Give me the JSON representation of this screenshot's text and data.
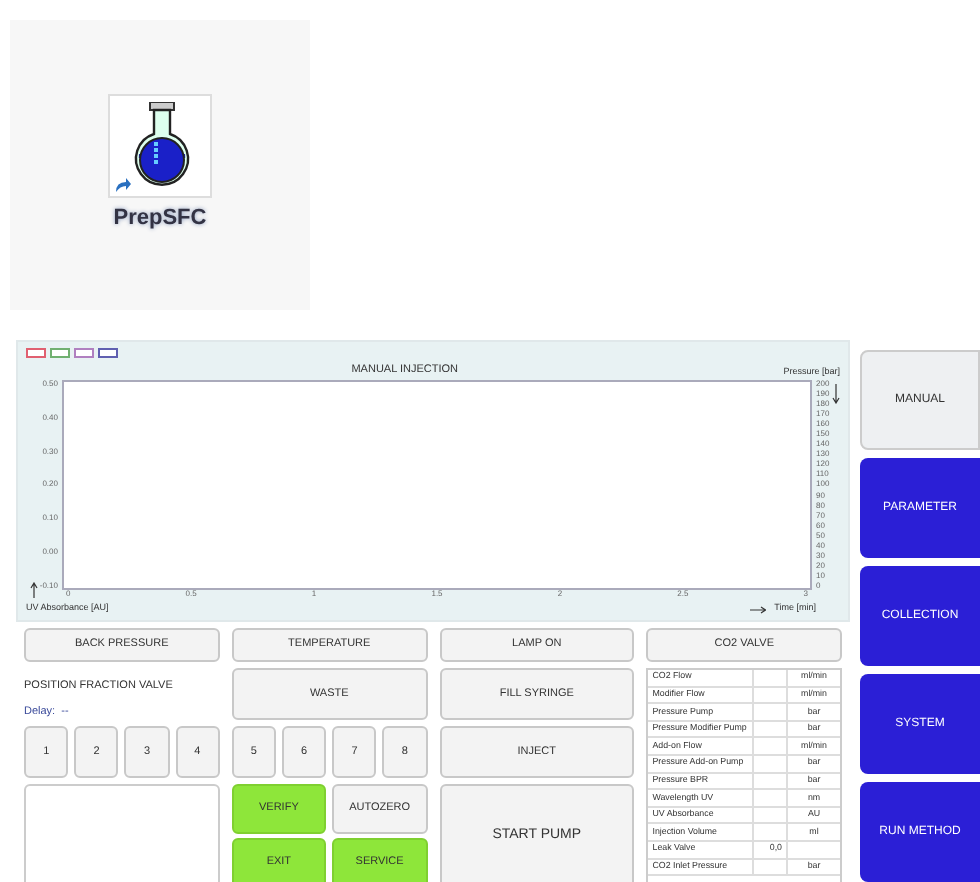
{
  "desktop_icon": {
    "label": "PrepSFC"
  },
  "chart": {
    "legend": [
      {
        "color": "#e06070"
      },
      {
        "color": "#70b070"
      },
      {
        "color": "#b080c0"
      },
      {
        "color": "#6060b0"
      }
    ],
    "title": "MANUAL INJECTION",
    "right_axis_label": "Pressure [bar]",
    "left_axis_label": "UV Absorbance [AU]",
    "x_axis_label": "Time [min]",
    "left_ticks": [
      "0.50",
      "0.40",
      "0.30",
      "0.20",
      "0.10",
      "0.00",
      "-0.10"
    ],
    "x_ticks": [
      "0",
      "0.5",
      "1",
      "1.5",
      "2",
      "2.5",
      "3"
    ],
    "right_ticks": [
      "200",
      "190",
      "180",
      "170",
      "160",
      "150",
      "140",
      "130",
      "120",
      "110",
      "100",
      "90",
      "80",
      "70",
      "60",
      "50",
      "40",
      "30",
      "20",
      "10",
      "0"
    ]
  },
  "top_buttons": [
    "BACK PRESSURE",
    "TEMPERATURE",
    "LAMP ON",
    "CO2 VALVE"
  ],
  "fraction_valve": {
    "title": "POSITION FRACTION VALVE",
    "delay": "Delay:  --",
    "positions": [
      "1",
      "2",
      "3",
      "4",
      "5",
      "6",
      "7",
      "8"
    ]
  },
  "buttons": [
    {
      "label": "WASTE"
    },
    {
      "label": "FILL SYRINGE"
    },
    {
      "label": "INJECT"
    },
    {
      "label": "START PUMP"
    }
  ],
  "small_buttons": [
    {
      "label": "VERIFY",
      "highlighted": true
    },
    {
      "label": "AUTOZERO",
      "highlighted": false
    },
    {
      "label": "EXIT",
      "highlighted": true
    },
    {
      "label": "SERVICE",
      "highlighted": true
    }
  ],
  "readings": [
    {
      "name": "CO2 Flow",
      "unit": "ml/min"
    },
    {
      "name": "Modifier Flow",
      "unit": "ml/min"
    },
    {
      "name": "Pressure Pump",
      "unit": "bar"
    },
    {
      "name": "Pressure Modifier Pump",
      "unit": "bar"
    },
    {
      "name": "Add-on Flow",
      "unit": "ml/min"
    },
    {
      "name": "Pressure Add-on Pump",
      "unit": "bar"
    },
    {
      "name": "Pressure BPR",
      "unit": "bar"
    },
    {
      "name": "Wavelength UV",
      "unit": "nm"
    },
    {
      "name": "UV Absorbance",
      "unit": "AU"
    },
    {
      "name": "Injection Volume",
      "unit": "ml"
    },
    {
      "name": "Leak Valve",
      "value": "0,0"
    },
    {
      "name": "CO2 Inlet Pressure",
      "unit": "bar"
    }
  ],
  "nav": [
    {
      "label": "MANUAL",
      "selected": true
    },
    {
      "label": "PARAMETER",
      "selected": false
    },
    {
      "label": "COLLECTION",
      "selected": false
    },
    {
      "label": "SYSTEM",
      "selected": false
    },
    {
      "label": "RUN METHOD",
      "selected": false
    }
  ]
}
